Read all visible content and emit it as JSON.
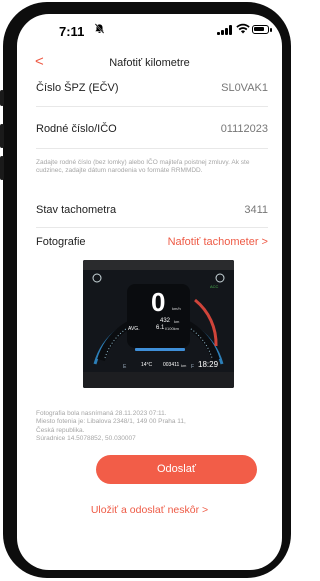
{
  "status_bar": {
    "time": "7:11",
    "mute_icon": "bell-slash-icon",
    "signal_icon": "cellular-signal-icon",
    "wifi_icon": "wifi-icon",
    "battery_icon": "battery-icon"
  },
  "header": {
    "back_icon": "chevron-left-icon",
    "back_glyph": "<",
    "title": "Nafotiť kilometre"
  },
  "form": {
    "plate_label": "Číslo ŠPZ (EČV)",
    "plate_value": "SL0VAK1",
    "id_label": "Rodné číslo/IČO",
    "id_value": "01112023",
    "id_hint": "Zadajte rodné číslo (bez lomky) alebo IČO majiteľa poistnej zmluvy. Ak ste cudzinec, zadajte dátum narodenia vo formáte RRMMDD.",
    "odometer_label": "Stav tachometra",
    "odometer_value": "3411",
    "photo_label": "Fotografie",
    "photo_link": "Nafotiť tachometer >"
  },
  "dashboard_photo": {
    "speed": "0",
    "speed_unit": "km/h",
    "distance": "432",
    "distance_unit": "km",
    "avg_label": "AVG.",
    "consumption": "6.1",
    "consumption_unit": "l/100km",
    "temperature": "14°C",
    "odometer": "003411",
    "odometer_unit": "km",
    "clock": "18:29",
    "acc_label": "ACC"
  },
  "photo_meta": {
    "line1": "Fotografia bola nasnímaná 28.11.2023 07:11.",
    "line2": "Miesto fotenia je: Libalova 2348/1, 149 00 Praha 11,",
    "line3": "Česká republika.",
    "line4": "Súradnice 14.5078852, 50.030007"
  },
  "actions": {
    "send_label": "Odoslať",
    "later_label": "Uložiť a odoslať neskôr >"
  },
  "colors": {
    "accent": "#ee5a45",
    "button": "#f25d48",
    "hint_text": "#a6a6a6",
    "value_text": "#777777"
  }
}
